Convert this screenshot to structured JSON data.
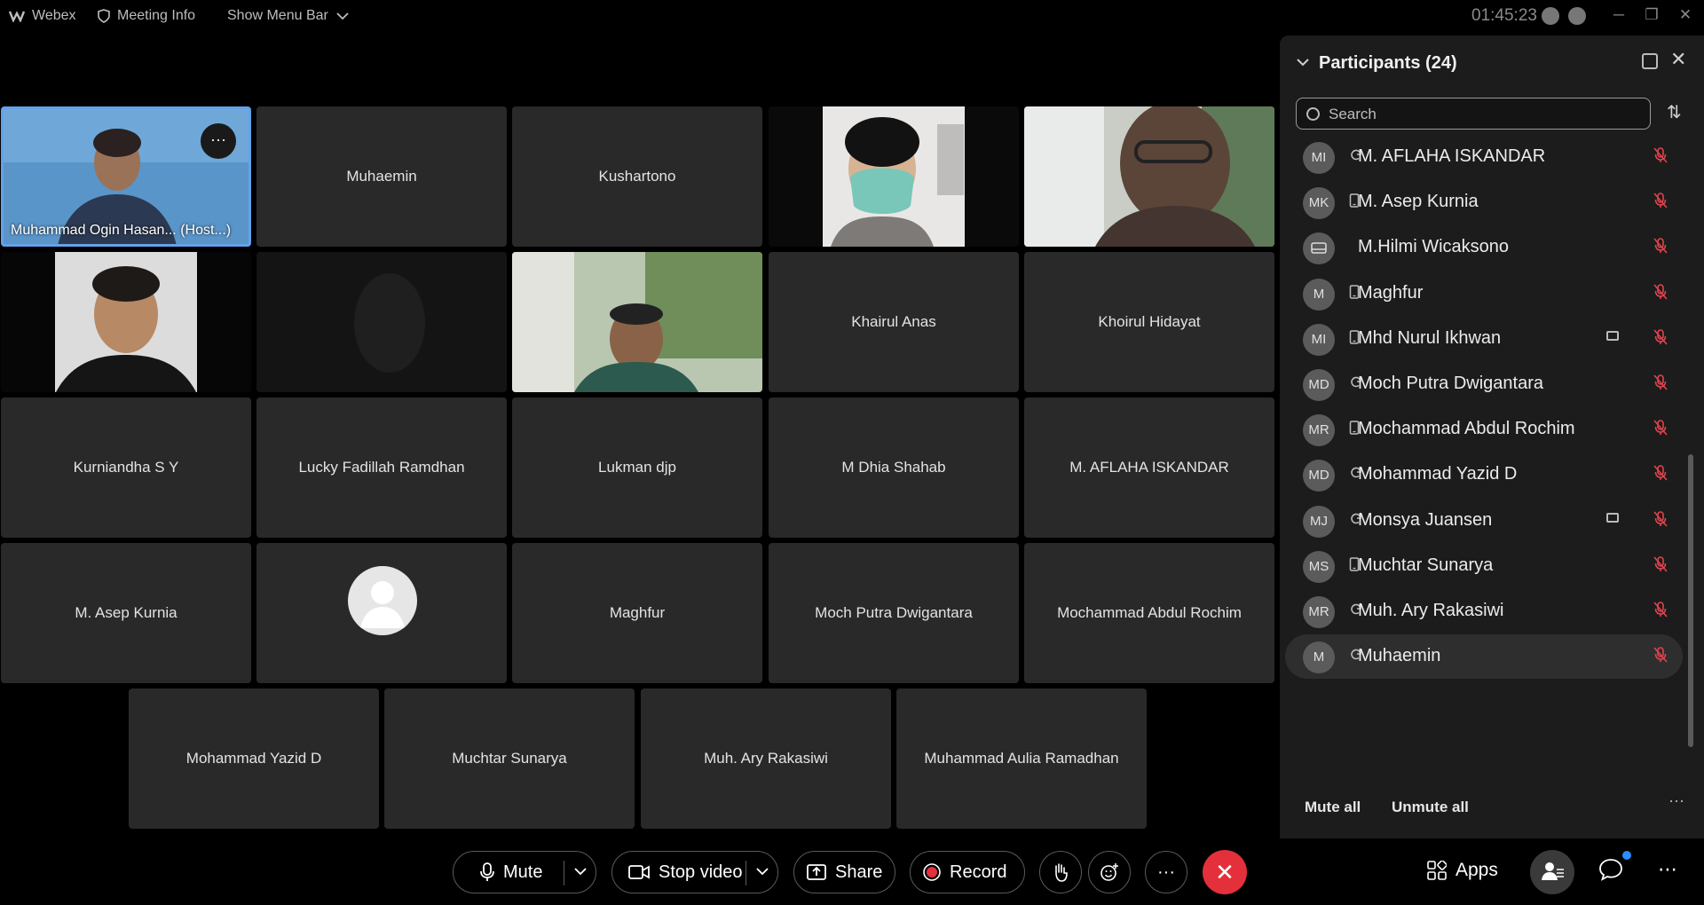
{
  "topbar": {
    "app_name": "Webex",
    "meeting_info": "Meeting Info",
    "show_menu_bar": "Show Menu Bar",
    "timer": "01:45:23"
  },
  "grid": {
    "host_caption": "Muhammad Ogin Hasan... (Host...)",
    "tiles": [
      "Muhaemin",
      "Kushartono",
      "Khairul Anas",
      "Khoirul Hidayat",
      "Kurniandha S Y",
      "Lucky Fadillah Ramdhan",
      "Lukman djp",
      "M Dhia Shahab",
      "M. AFLAHA ISKANDAR",
      "M. Asep Kurnia",
      "Maghfur",
      "Moch Putra Dwigantara",
      "Mochammad Abdul Rochim",
      "Mohammad Yazid D",
      "Muchtar Sunarya",
      "Muh. Ary Rakasiwi",
      "Muhammad Aulia Ramadhan"
    ]
  },
  "participants": {
    "title": "Participants (24)",
    "search_placeholder": "Search",
    "list": [
      {
        "initials": "MI",
        "name": "M. AFLAHA ISKANDAR",
        "device": "sync-icon",
        "video": false
      },
      {
        "initials": "MK",
        "name": "M. Asep Kurnia",
        "device": "phone-icon",
        "video": false
      },
      {
        "initials": "",
        "name": "M.Hilmi Wicaksono",
        "device": "room-icon",
        "video": false
      },
      {
        "initials": "M",
        "name": "Maghfur",
        "device": "phone-icon",
        "video": false
      },
      {
        "initials": "MI",
        "name": "Mhd Nurul Ikhwan",
        "device": "phone-icon",
        "video": true
      },
      {
        "initials": "MD",
        "name": "Moch Putra Dwigantara",
        "device": "sync-icon",
        "video": false
      },
      {
        "initials": "MR",
        "name": "Mochammad Abdul Rochim",
        "device": "phone-icon",
        "video": false
      },
      {
        "initials": "MD",
        "name": "Mohammad Yazid D",
        "device": "sync-icon",
        "video": false
      },
      {
        "initials": "MJ",
        "name": "Monsya Juansen",
        "device": "sync-icon",
        "video": true
      },
      {
        "initials": "MS",
        "name": "Muchtar Sunarya",
        "device": "phone-icon",
        "video": false
      },
      {
        "initials": "MR",
        "name": "Muh. Ary Rakasiwi",
        "device": "sync-icon",
        "video": false
      },
      {
        "initials": "M",
        "name": "Muhaemin",
        "device": "sync-icon",
        "video": false
      }
    ],
    "mute_all": "Mute all",
    "unmute_all": "Unmute all"
  },
  "controls": {
    "mute": "Mute",
    "stop_video": "Stop video",
    "share": "Share",
    "record": "Record",
    "apps": "Apps"
  },
  "colors": {
    "accent": "#63a2ea",
    "end_call": "#e4303b",
    "record_dot": "#e4303b",
    "mute_icon": "#e0444e",
    "notification": "#2d8cff"
  }
}
